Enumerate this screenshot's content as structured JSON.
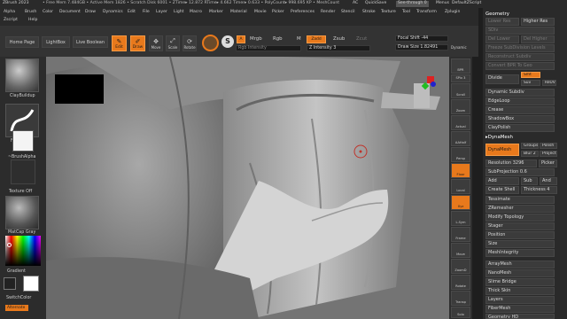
{
  "title": {
    "app": "ZBrush 2023",
    "stats": "• Free Mem 7.484GB • Active Mem 1826 • Scratch Disk 6001 • ZTime▸ 12.872 RTime▸ 4.662 Timer▸ 0.633 • PolyCount▸ 998.695 KP • MeshCount",
    "ac": "AC",
    "quicksave": "QuickSave",
    "seethrough": "See-through  0",
    "menus_btn": "Menus",
    "script": "DefaultZScript"
  },
  "menu1": [
    "Alpha",
    "Brush",
    "Color",
    "Document",
    "Draw",
    "Dynamics",
    "Edit",
    "File",
    "Layer",
    "Light",
    "Macro",
    "Marker",
    "Material",
    "Movie",
    "Picker",
    "Preferences",
    "Render",
    "Stencil",
    "Stroke",
    "Texture",
    "Tool",
    "Transform",
    "Zplugin"
  ],
  "menu2": [
    "Zscript",
    "Help"
  ],
  "toolbar": {
    "home": "Home Page",
    "lightbox": "LightBox",
    "liveboolean": "Live Boolean",
    "edit": "Edit",
    "draw": "Draw",
    "move": "Move",
    "scale": "Scale",
    "rotate": "Rotate",
    "a": "A",
    "mrgb": "Mrgb",
    "rgb": "Rgb",
    "m": "M",
    "zadd": "Zadd",
    "zsub": "Zsub",
    "zcut": "Zcut",
    "rgb_intensity": "Rgb Intensity",
    "z_intensity": "Z Intensity 3",
    "focal_shift": "Focal Shift -44",
    "draw_size": "Draw Size 1.82491",
    "dynamic": "Dynamic"
  },
  "left": {
    "brush": "ClayBuildup",
    "stroke": "FreeHand",
    "alpha": "~BrushAlpha",
    "texture": "Texture Off",
    "material": "MatCap Gray",
    "gradient": "Gradient",
    "switchcolor": "SwitchColor",
    "alternate": "Alternate"
  },
  "rightshelf": [
    "BPR",
    "SPix 3",
    "Scroll",
    "Zoom",
    "Actual",
    "AAHalf",
    "Persp",
    "Floor",
    "Local",
    "Xyz",
    "L.Sym",
    "Frame",
    "Move",
    "ZoomD",
    "Rotate",
    "Transp",
    "Solo"
  ],
  "panel": {
    "geometry": "Geometry",
    "lower_res": "Lower Res",
    "higher_res": "Higher Res",
    "sdiv": "SDiv",
    "del_lower": "Del Lower",
    "del_higher": "Del Higher",
    "freeze": "Freeze SubDivision Levels",
    "reconstruct": "Reconstruct Subdiv",
    "convert_bpr": "Convert BPR To Geo",
    "divide": "Divide",
    "smt": "Smt",
    "suv": "Suv",
    "reuv": "ReUV",
    "dyn_subdiv": "Dynamic Subdiv",
    "edgeloop": "EdgeLoop",
    "crease": "Crease",
    "shadowbox": "ShadowBox",
    "claypolish": "ClayPolish",
    "dynamesh_head": "▸DynaMesh",
    "dynamesh": "DynaMesh",
    "groups": "Groups",
    "polish": "Polish",
    "blur": "Blur 2",
    "project": "Project",
    "resolution": "Resolution 3296",
    "picker": "Picker",
    "subprojection": "SubProjection 0.6",
    "add": "Add",
    "sub": "Sub",
    "and": "And",
    "create_shell": "Create Shell",
    "thickness": "Thickness 4",
    "tessimate": "Tessimate",
    "zremesher": "ZRemesher",
    "modify_topology": "Modify Topology",
    "stager": "Stager",
    "position": "Position",
    "size": "Size",
    "meshintegrity": "MeshIntegrity",
    "arraymesh": "ArrayMesh",
    "nanomesh": "NanoMesh",
    "slime_bridge": "Slime Bridge",
    "thick_skin": "Thick Skin",
    "layers": "Layers",
    "fibermesh": "FiberMesh",
    "geometry_hd": "Geometry HD"
  },
  "colors": {
    "accent": "#e8791c",
    "bg": "#2a2a2a",
    "viewport": "#7a7a7a"
  }
}
